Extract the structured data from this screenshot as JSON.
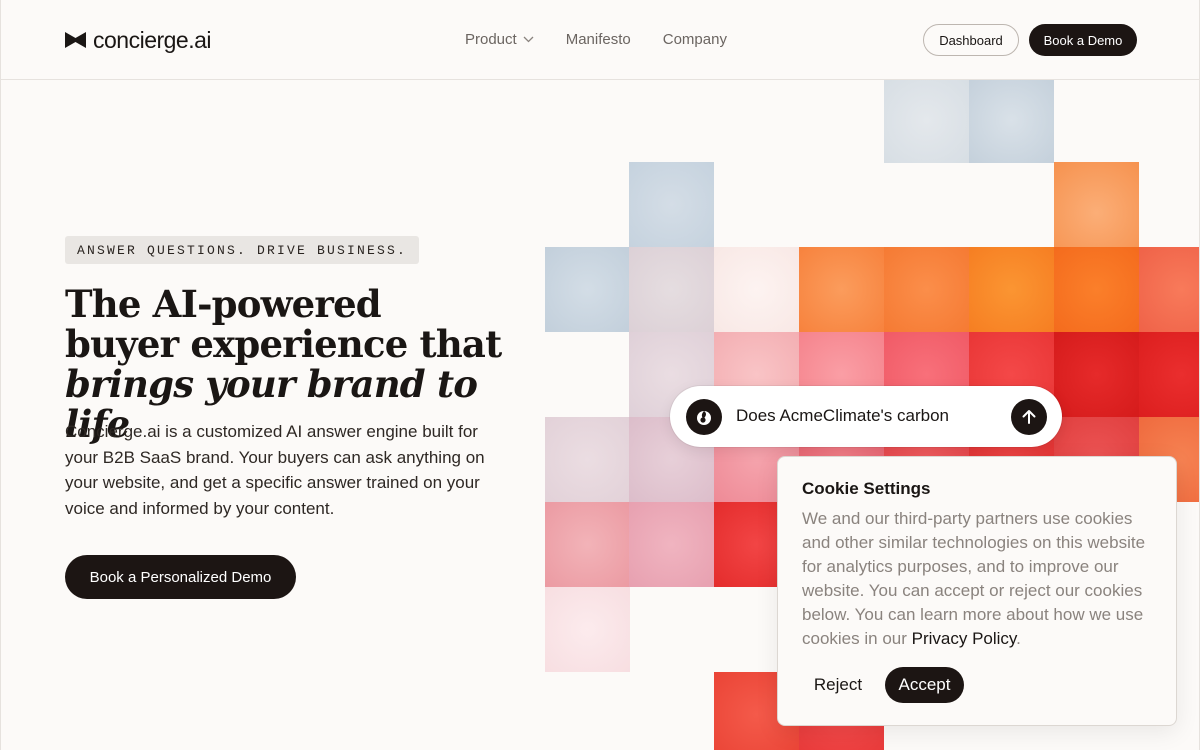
{
  "header": {
    "logo_text": "concierge.ai",
    "nav": [
      {
        "label": "Product",
        "has_dropdown": true
      },
      {
        "label": "Manifesto"
      },
      {
        "label": "Company"
      }
    ],
    "dashboard_label": "Dashboard",
    "book_demo_label": "Book a Demo"
  },
  "hero": {
    "eyebrow": "ANSWER QUESTIONS. DRIVE BUSINESS.",
    "headline_plain": "The AI-powered buyer experience that ",
    "headline_italic": "brings your brand to life",
    "lede": "Concierge.ai is a customized AI answer engine built for your B2B SaaS brand. Your buyers can ask anything on your website, and get a specific answer trained on your voice and informed by your content.",
    "cta_label": "Book a Personalized Demo"
  },
  "chat": {
    "query_text": "Does AcmeClimate's carbon"
  },
  "cookie": {
    "title": "Cookie Settings",
    "body": "We and our third-party partners use cookies and other similar technologies on this website for analytics purposes, and to improve our website. You can accept or reject our cookies below. You can learn more about how we use cookies in our ",
    "privacy_link": "Privacy Policy",
    "body_end": ".",
    "reject_label": "Reject",
    "accept_label": "Accept"
  },
  "colors": {
    "brand_dark": "#1c1513",
    "background": "#fcfaf8",
    "accent_orange": "#f26b1d",
    "accent_red": "#e42323"
  }
}
